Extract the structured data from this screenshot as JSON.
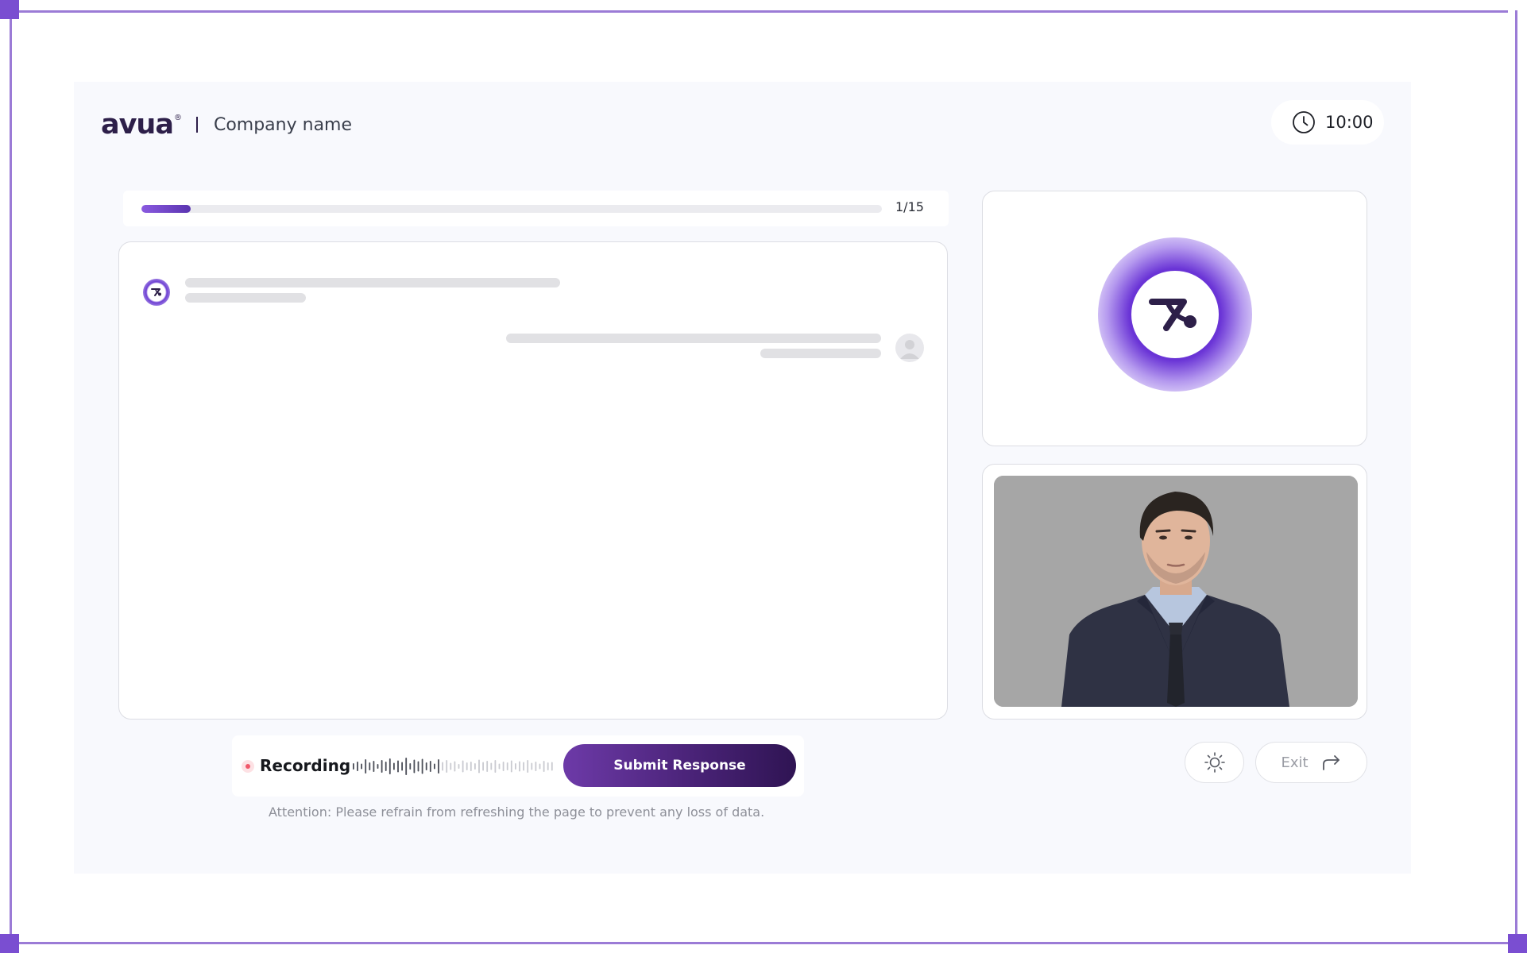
{
  "header": {
    "brand": "avua",
    "brand_mark": "®",
    "company": "Company name",
    "timer": "10:00"
  },
  "progress": {
    "label": "1/15",
    "current": 1,
    "total": 15
  },
  "controls": {
    "recording_label": "Recording",
    "submit_label": "Submit Response",
    "exit_label": "Exit"
  },
  "notice": "Attention: Please refrain from refreshing the page to prevent any loss of data.",
  "icons": {
    "timer": "clock-icon",
    "bot": "avua-bot-icon",
    "user": "user-avatar-icon",
    "recording": "recording-dot-icon",
    "waveform": "audio-waveform-icon",
    "theme": "sun-icon",
    "exit": "exit-arrow-icon"
  },
  "colors": {
    "accent": "#6d3fd3",
    "brand_dark": "#2d1f49",
    "submit_gradient_start": "#6d3aa8",
    "submit_gradient_end": "#2f1453",
    "recording": "#f0586a",
    "frame": "#9b7bd6"
  }
}
